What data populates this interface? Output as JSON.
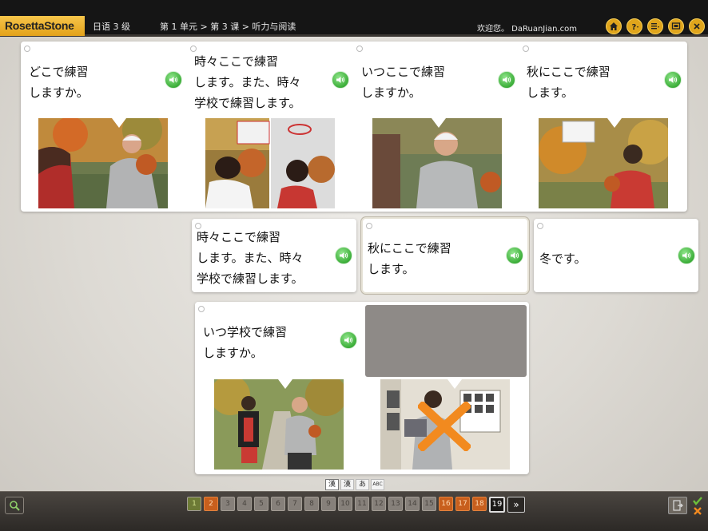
{
  "header": {
    "brand": "RosettaStone",
    "language": "日语 3 级",
    "breadcrumb": "第 1 单元 > 第 3 课 > 听力与阅读",
    "welcome": "欢迎您。 DaRuanJian.com",
    "icons": [
      "home-icon",
      "help-icon",
      "menu-icon",
      "settings-icon",
      "close-icon"
    ]
  },
  "top_row": [
    {
      "lines": [
        "どこで練習",
        "しますか。"
      ],
      "icon": "sound-icon"
    },
    {
      "lines": [
        "時々ここで練習",
        "します。また、時々",
        "学校で練習します。"
      ],
      "icon": "sound-icon"
    },
    {
      "lines": [
        "いつここで練習",
        "しますか。"
      ],
      "icon": "sound-icon"
    },
    {
      "lines": [
        "秋にここで練習",
        "します。"
      ],
      "icon": "sound-icon"
    }
  ],
  "middle_row": [
    {
      "lines": [
        "時々ここで練習",
        "します。また、時々",
        "学校で練習します。"
      ]
    },
    {
      "lines": [
        "秋にここで練習",
        "します。"
      ]
    },
    {
      "lines": [
        "冬です。"
      ]
    }
  ],
  "bottom_card": {
    "lines": [
      "いつ学校で練習",
      "しますか。"
    ]
  },
  "script_options": [
    "漢",
    "漢",
    "あ",
    "ABC"
  ],
  "pager": {
    "pages": [
      "1",
      "2",
      "3",
      "4",
      "5",
      "6",
      "7",
      "8",
      "9",
      "10",
      "11",
      "12",
      "13",
      "14",
      "15",
      "16",
      "17",
      "18",
      "19"
    ],
    "done": [
      "1"
    ],
    "errors": [
      "2",
      "16",
      "17",
      "18"
    ],
    "current": "19",
    "next_label": "»"
  },
  "colors": {
    "accent": "#e3a21a",
    "sound": "#3cae39",
    "error": "#f28a1f",
    "topbar": "#151515"
  }
}
